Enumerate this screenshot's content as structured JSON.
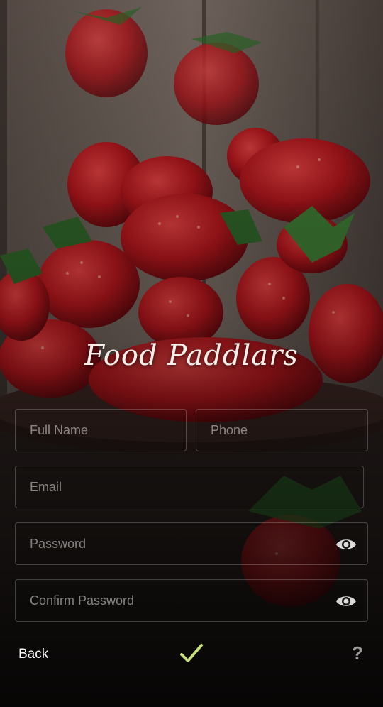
{
  "app": {
    "brand_title": "Food Paddlars"
  },
  "form": {
    "full_name": {
      "placeholder": "Full Name",
      "value": ""
    },
    "phone": {
      "placeholder": "Phone",
      "value": ""
    },
    "email": {
      "placeholder": "Email",
      "value": ""
    },
    "password": {
      "placeholder": "Password",
      "value": "",
      "icon": "eye-icon"
    },
    "confirm_password": {
      "placeholder": "Confirm Password",
      "value": "",
      "icon": "eye-icon"
    }
  },
  "bottom_bar": {
    "back_label": "Back",
    "confirm_icon": "check-icon",
    "help_label": "?"
  },
  "colors": {
    "accent_check": "#c8e07a",
    "text_primary": "#ffffff",
    "help_gray": "#9a9a9a"
  }
}
